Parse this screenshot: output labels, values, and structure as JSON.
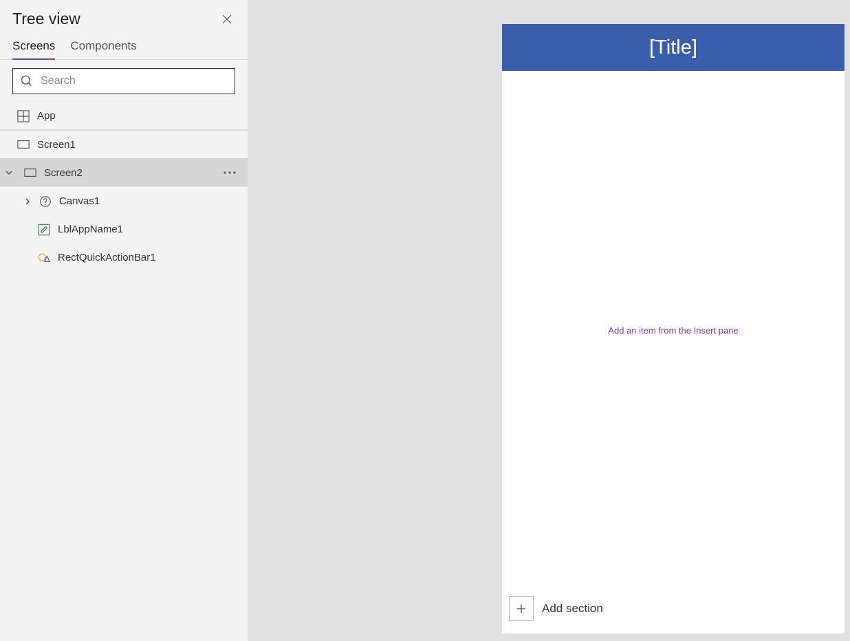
{
  "sidebar": {
    "title": "Tree view",
    "tabs": {
      "screens": "Screens",
      "components": "Components"
    },
    "search_placeholder": "Search",
    "items": {
      "app": "App",
      "screen1": "Screen1",
      "screen2": "Screen2",
      "canvas1": "Canvas1",
      "lblappname1": "LblAppName1",
      "rectquickactionbar1": "RectQuickActionBar1"
    }
  },
  "canvas": {
    "title": "[Title]",
    "placeholder": "Add an item from the Insert pane",
    "add_section": "Add section"
  }
}
